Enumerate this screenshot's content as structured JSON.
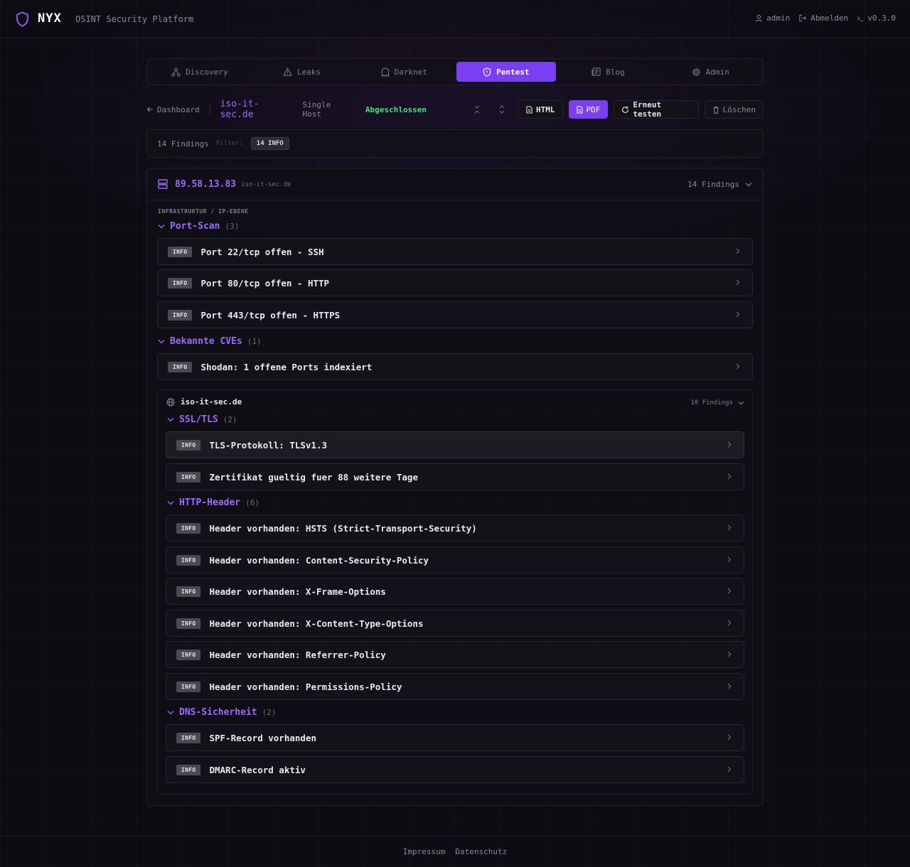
{
  "brand": {
    "name": "NYX",
    "subtitle": "OSINT Security Platform"
  },
  "topbar": {
    "user": "admin",
    "logout": "Abmelden",
    "version": "v0.3.0"
  },
  "nav": [
    {
      "label": "Discovery",
      "icon": "network-icon",
      "active": false
    },
    {
      "label": "Leaks",
      "icon": "warning-icon",
      "active": false
    },
    {
      "label": "Darknet",
      "icon": "ghost-icon",
      "active": false
    },
    {
      "label": "Pentest",
      "icon": "shield-icon",
      "active": true
    },
    {
      "label": "Blog",
      "icon": "newspaper-icon",
      "active": false
    },
    {
      "label": "Admin",
      "icon": "gear-icon",
      "active": false
    }
  ],
  "toolbar": {
    "back": "Dashboard",
    "host": "iso-it-sec.de",
    "mode": "Single Host",
    "status": "Abgeschlossen",
    "html": "HTML",
    "pdf": "PDF",
    "retest": "Erneut testen",
    "delete": "Löschen"
  },
  "filter": {
    "count": "14 Findings",
    "label": "Filter:",
    "chip": "14 INFO"
  },
  "host_panel": {
    "ip": "89.58.13.83",
    "hostname": "iso-it-sec.de",
    "findings": "14 Findings",
    "section": "INFRASTRUKTUR / IP-EBENE",
    "categories": [
      {
        "name": "Port-Scan",
        "count": "(3)",
        "items": [
          {
            "badge": "INFO",
            "title": "Port 22/tcp offen - SSH"
          },
          {
            "badge": "INFO",
            "title": "Port 80/tcp offen - HTTP"
          },
          {
            "badge": "INFO",
            "title": "Port 443/tcp offen - HTTPS"
          }
        ]
      },
      {
        "name": "Bekannte CVEs",
        "count": "(1)",
        "items": [
          {
            "badge": "INFO",
            "title": "Shodan: 1 offene Ports indexiert"
          }
        ]
      }
    ]
  },
  "domain_panel": {
    "domain": "iso-it-sec.de",
    "findings": "10 Findings",
    "categories": [
      {
        "name": "SSL/TLS",
        "count": "(2)",
        "items": [
          {
            "badge": "INFO",
            "title": "TLS-Protokoll: TLSv1.3"
          },
          {
            "badge": "INFO",
            "title": "Zertifikat gueltig fuer 88 weitere Tage"
          }
        ]
      },
      {
        "name": "HTTP-Header",
        "count": "(6)",
        "items": [
          {
            "badge": "INFO",
            "title": "Header vorhanden: HSTS (Strict-Transport-Security)"
          },
          {
            "badge": "INFO",
            "title": "Header vorhanden: Content-Security-Policy"
          },
          {
            "badge": "INFO",
            "title": "Header vorhanden: X-Frame-Options"
          },
          {
            "badge": "INFO",
            "title": "Header vorhanden: X-Content-Type-Options"
          },
          {
            "badge": "INFO",
            "title": "Header vorhanden: Referrer-Policy"
          },
          {
            "badge": "INFO",
            "title": "Header vorhanden: Permissions-Policy"
          }
        ]
      },
      {
        "name": "DNS-Sicherheit",
        "count": "(2)",
        "items": [
          {
            "badge": "INFO",
            "title": "SPF-Record vorhanden"
          },
          {
            "badge": "INFO",
            "title": "DMARC-Record aktiv"
          }
        ]
      }
    ]
  },
  "footer": {
    "impressum": "Impressum",
    "datenschutz": "Datenschutz"
  },
  "colors": {
    "accent": "#7b3ff2",
    "accent_text": "#9b6bff",
    "status_ok": "#4ade80",
    "background": "#0d0c12"
  }
}
